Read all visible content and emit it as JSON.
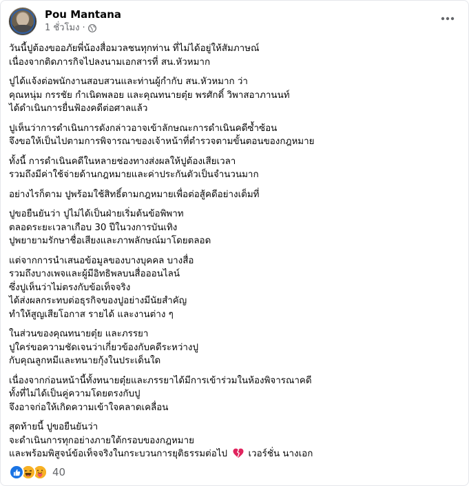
{
  "post": {
    "author": "Pou Mantana",
    "time": "1 ชั่วโมง",
    "separator": "·",
    "privacy_icon": "globe-icon",
    "more_icon": "ellipsis-icon",
    "paragraphs": [
      [
        "วันนี้ปูต้องขออภัยพี่น้องสื่อมวลชนทุกท่าน ที่ไม่ได้อยู่ให้สัมภาษณ์",
        "เนื่องจากติดภารกิจไปลงนามเอกสารที่ สน.หัวหมาก"
      ],
      [
        "ปูได้แจ้งต่อพนักงานสอบสวนและท่านผู้กำกับ สน.หัวหมาก ว่า",
        "คุณหนุ่ม กรรชัย กำเนิดพลอย และคุณทนายตุ๋ย พรศักดิ์ วิพาสอาภานนท์",
        "ได้ดำเนินการยื่นฟ้องคดีต่อศาลแล้ว"
      ],
      [
        "ปูเห็นว่าการดำเนินการดังกล่าวอาจเข้าลักษณะการดำเนินคดีซ้ำซ้อน",
        "จึงขอให้เป็นไปตามการพิจารณาของเจ้าหน้าที่ตำรวจตามขั้นตอนของกฎหมาย"
      ],
      [
        "ทั้งนี้ การดำเนินคดีในหลายช่องทางส่งผลให้ปูต้องเสียเวลา",
        "รวมถึงมีค่าใช้จ่ายด้านกฎหมายและค่าประกันตัวเป็นจำนวนมาก"
      ],
      [
        "อย่างไรก็ตาม ปูพร้อมใช้สิทธิ์ตามกฎหมายเพื่อต่อสู้คดีอย่างเต็มที่"
      ],
      [
        "ปูขอยืนยันว่า ปูไม่ได้เป็นฝ่ายเริ่มต้นข้อพิพาท",
        "ตลอดระยะเวลาเกือบ 30 ปีในวงการบันเทิง",
        "ปูพยายามรักษาชื่อเสียงและภาพลักษณ์มาโดยตลอด"
      ],
      [
        "แต่จากการนำเสนอข้อมูลของบางบุคคล บางสื่อ",
        "รวมถึงบางเพจและผู้มีอิทธิพลบนสื่อออนไลน์",
        "ซึ่งปูเห็นว่าไม่ตรงกับข้อเท็จจริง",
        "ได้ส่งผลกระทบต่อธุรกิจของปูอย่างมีนัยสำคัญ",
        "ทำให้สูญเสียโอกาส รายได้ และงานต่าง ๆ"
      ],
      [
        "ในส่วนของคุณทนายตุ๋ย และภรรยา",
        "ปูใคร่ขอความชัดเจนว่าเกี่ยวข้องกับคดีระหว่างปู",
        "กับคุณลูกหมีและทนายกุ้งในประเด็นใด"
      ],
      [
        "เนื่องจากก่อนหน้านี้ทั้งทนายตุ๋ยและภรรยาได้มีการเข้าร่วมในห้องพิจารณาคดี",
        "ทั้งที่ไม่ได้เป็นคู่ความโดยตรงกับปู",
        "จึงอาจก่อให้เกิดความเข้าใจคลาดเคลื่อน"
      ]
    ],
    "closing": {
      "line1": "สุดท้ายนี้ ปูขอยืนยันว่า",
      "line2": "จะดำเนินการทุกอย่างภายใต้กรอบของกฎหมาย",
      "line3_before": "และพร้อมพิสูจน์ข้อเท็จจริงในกระบวนการยุติธรรมต่อไป",
      "line3_icon": "broken-heart-icon",
      "line3_after": "เวอร์ชั่น นางเอก"
    },
    "reactions": {
      "icons": [
        "like-icon",
        "haha-icon",
        "care-icon"
      ],
      "count": "40"
    }
  },
  "colors": {
    "text": "#050505",
    "secondary": "#65676b",
    "like_blue": "#1b74e4",
    "emoji_yellow": "#f7b125",
    "heart_red": "#e0245e"
  }
}
